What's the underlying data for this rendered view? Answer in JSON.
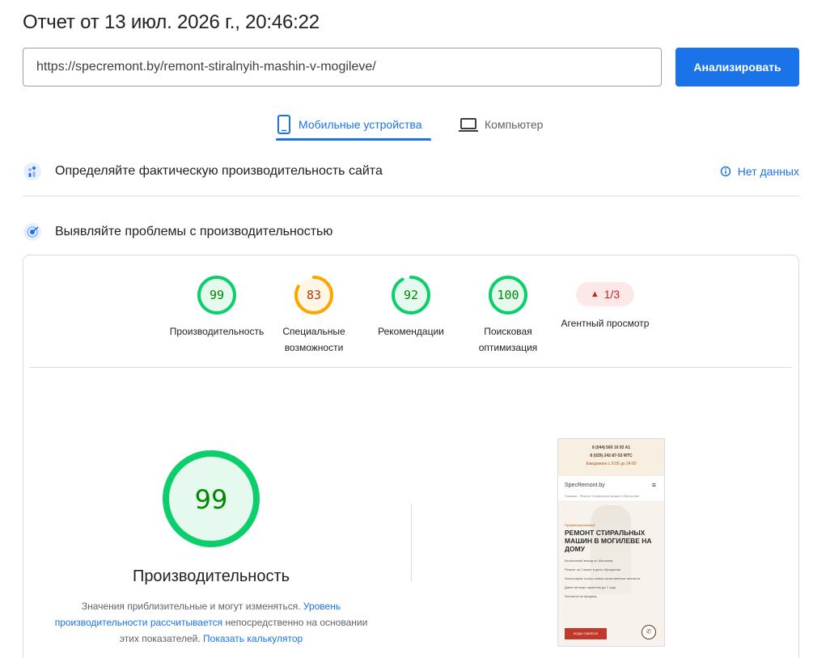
{
  "header": {
    "report_title": "Отчет от 13 июл. 2026 г., 20:46:22",
    "url_value": "https://specremont.by/remont-stiralnyih-mashin-v-mogileve/",
    "analyze_label": "Анализировать"
  },
  "tabs": [
    {
      "label": "Мобильные устройства",
      "icon": "smartphone-icon",
      "active": true
    },
    {
      "label": "Компьютер",
      "icon": "laptop-icon",
      "active": false
    }
  ],
  "field_data": {
    "title": "Определяйте фактическую производительность сайта",
    "status": "Нет данных"
  },
  "lab_data": {
    "title": "Выявляйте проблемы с производительностью"
  },
  "scores": [
    {
      "value": 99,
      "label": "Производительность",
      "color": "#0cce6b"
    },
    {
      "value": 83,
      "label": "Специальные возможности",
      "color": "#ffa400"
    },
    {
      "value": 92,
      "label": "Рекомендации",
      "color": "#0cce6b"
    },
    {
      "value": 100,
      "label": "Поисковая оптимизация",
      "color": "#0cce6b"
    }
  ],
  "agent_view": {
    "badge": "1/3",
    "label": "Агентный просмотр"
  },
  "performance": {
    "score": 99,
    "label": "Производительность",
    "note_before": "Значения приблизительные и могут изменяться. ",
    "note_link1": "Уровень производительности рассчитывается",
    "note_middle": " непосредственно на основании этих показателей. ",
    "note_link2": "Показать калькулятор"
  },
  "screenshot": {
    "phone1": "8 (044) 560 16 92 A1",
    "phone2": "8 (029) 242-87-53 МТС",
    "hours": "Ежедневно с 9:00 до 24:00",
    "site": "SpecRemont.by",
    "crumb": "Главная › Ремонт стиральных машин в Могилеве",
    "pre": "Профессиональный",
    "headline": "РЕМОНТ СТИРАЛЬНЫХ МАШИН В МОГИЛЕВЕ НА ДОМУ",
    "bullets": [
      "Бесплатный выезд по Могилеву",
      "Ремонт за 1 визит в день обращения",
      "Используем только новые качественные запчасти",
      "Даем честную гарантию до 1 года",
      "Запчасти на продажу"
    ],
    "cta": "КОДЫ ОШИБОК"
  },
  "colors": {
    "accent": "#1a73e8",
    "pass": "#0cce6b",
    "average": "#ffa400",
    "fail": "#c5221f"
  }
}
